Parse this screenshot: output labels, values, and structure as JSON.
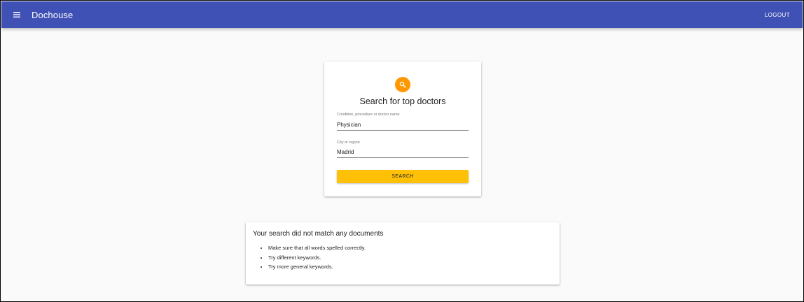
{
  "header": {
    "menu_icon": "menu-icon",
    "title": "Dochouse",
    "logout_label": "LOGOUT",
    "color": "#3f51b5"
  },
  "search_card": {
    "icon": "search-icon",
    "icon_color": "#ff9800",
    "title": "Search for top doctors",
    "condition": {
      "label": "Condition, procedure or doctor name",
      "value": "Physician"
    },
    "location": {
      "label": "City or region",
      "value": "Madrid"
    },
    "search_label": "SEARCH",
    "button_color": "#ffc107"
  },
  "results": {
    "title": "Your search did not match any documents",
    "tips": [
      "Make sure that all words spelled correctly.",
      "Try different keywords.",
      "Try more general keywords."
    ]
  }
}
